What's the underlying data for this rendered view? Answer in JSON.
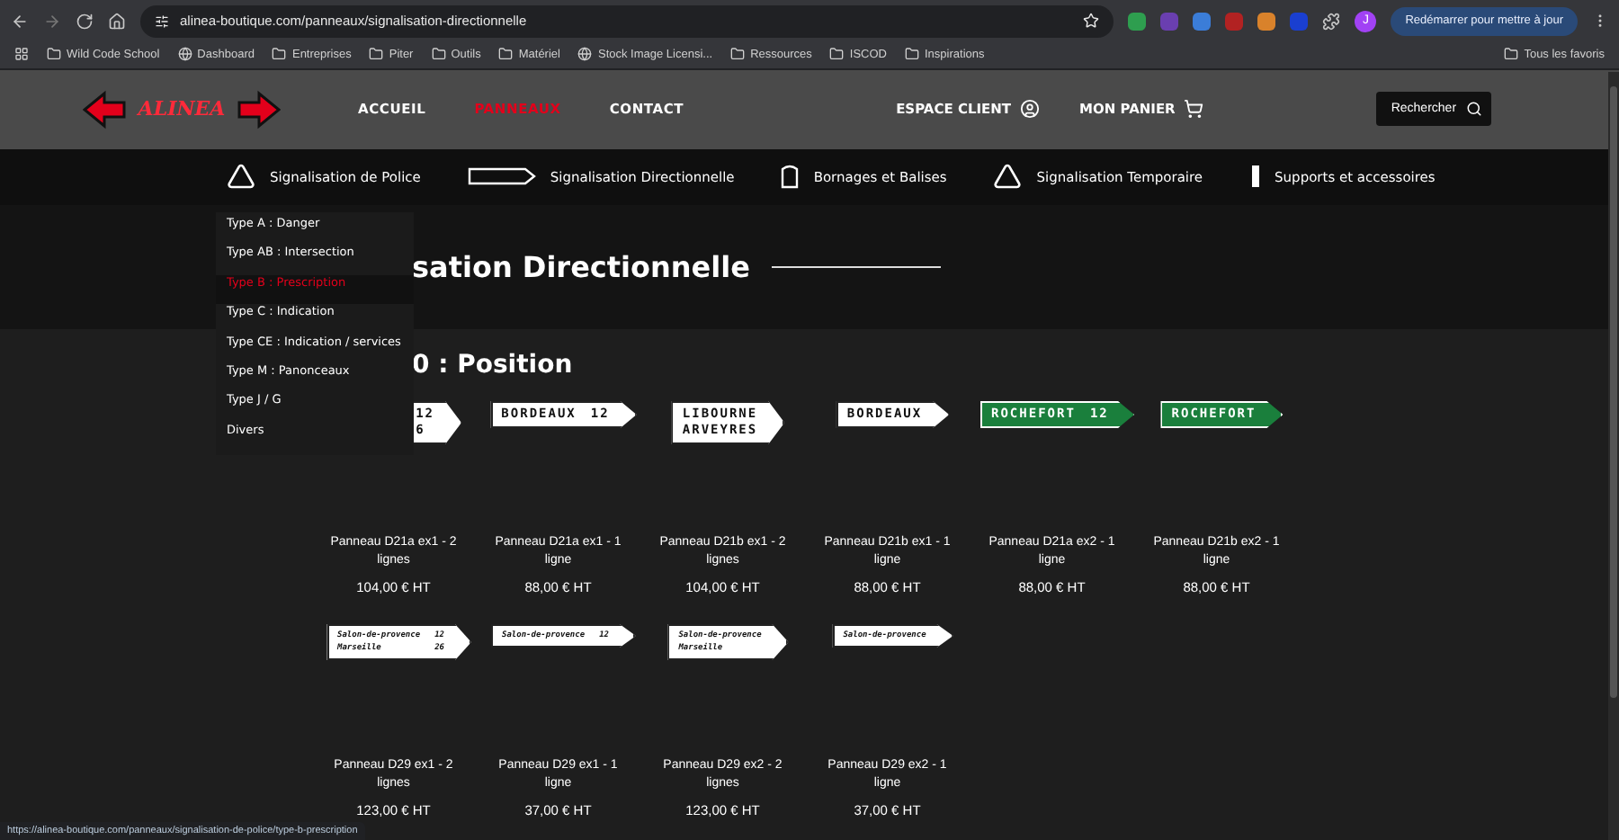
{
  "browser": {
    "url": "alinea-boutique.com/panneaux/signalisation-directionnelle",
    "profile_initial": "J",
    "update_button": "Redémarrer pour mettre à jour",
    "bookmarks": [
      {
        "label": "Wild Code School",
        "kind": "folder"
      },
      {
        "label": "Dashboard",
        "kind": "site"
      },
      {
        "label": "Entreprises",
        "kind": "folder"
      },
      {
        "label": "Piter",
        "kind": "folder"
      },
      {
        "label": "Outils",
        "kind": "folder"
      },
      {
        "label": "Matériel",
        "kind": "folder"
      },
      {
        "label": "Stock Image Licensi...",
        "kind": "site"
      },
      {
        "label": "Ressources",
        "kind": "folder"
      },
      {
        "label": "ISCOD",
        "kind": "folder"
      },
      {
        "label": "Inspirations",
        "kind": "folder"
      }
    ],
    "all_bookmarks": "Tous les favoris",
    "status_url": "https://alinea-boutique.com/panneaux/signalisation-de-police/type-b-prescription"
  },
  "header": {
    "logo": "ALINEA",
    "menu": [
      {
        "label": "ACCUEIL",
        "selected": false
      },
      {
        "label": "PANNEAUX",
        "selected": true
      },
      {
        "label": "CONTACT",
        "selected": false
      }
    ],
    "account": "ESPACE CLIENT",
    "cart": "MON PANIER",
    "search_button": "Rechercher"
  },
  "categories": [
    {
      "label": "Signalisation de Police",
      "kind": "triangle"
    },
    {
      "label": "Signalisation Directionnelle",
      "kind": "arrow"
    },
    {
      "label": "Bornages et Balises",
      "kind": "bollard"
    },
    {
      "label": "Signalisation Temporaire",
      "kind": "warning"
    },
    {
      "label": "Supports et accessoires",
      "kind": "post"
    }
  ],
  "dropdown": [
    {
      "label": "Type A : Danger",
      "selected": false
    },
    {
      "label": "Type AB : Intersection",
      "selected": false
    },
    {
      "label": "Type B : Prescription",
      "selected": true
    },
    {
      "label": "Type C : Indication",
      "selected": false
    },
    {
      "label": "Type CE : Indication / services",
      "selected": false
    },
    {
      "label": "Type M : Panonceaux",
      "selected": false
    },
    {
      "label": "Type J / G",
      "selected": false
    },
    {
      "label": "Divers",
      "selected": false
    }
  ],
  "page_title": "sation Directionnelle",
  "section_title": "0 : Position",
  "products": [
    {
      "name": "Panneau D21a ex1 - 2 lignes",
      "price": "104,00 € HT",
      "sign": {
        "kind": "block",
        "color": "#ffffff",
        "lines": [
          [
            "12"
          ],
          [
            "6"
          ]
        ]
      }
    },
    {
      "name": "Panneau D21a ex1 - 1 ligne",
      "price": "88,00 € HT",
      "sign": {
        "kind": "block",
        "color": "#ffffff",
        "lines": [
          [
            "BORDEAUX",
            "12"
          ]
        ]
      }
    },
    {
      "name": "Panneau D21b ex1 - 2 lignes",
      "price": "104,00 € HT",
      "sign": {
        "kind": "block",
        "color": "#ffffff",
        "lines": [
          [
            "LIBOURNE"
          ],
          [
            "ARVEYRES"
          ]
        ]
      }
    },
    {
      "name": "Panneau D21b ex1 - 1 ligne",
      "price": "88,00 € HT",
      "sign": {
        "kind": "block",
        "color": "#ffffff",
        "lines": [
          [
            "BORDEAUX"
          ]
        ]
      }
    },
    {
      "name": "Panneau D21a ex2 - 1 ligne",
      "price": "88,00 € HT",
      "sign": {
        "kind": "block",
        "color": "#1a7f3c",
        "lines": [
          [
            "ROCHEFORT",
            "12"
          ]
        ]
      }
    },
    {
      "name": "Panneau D21b ex2 - 1 ligne",
      "price": "88,00 € HT",
      "sign": {
        "kind": "block",
        "color": "#1a7f3c",
        "lines": [
          [
            "ROCHEFORT"
          ]
        ]
      }
    },
    {
      "name": "Panneau D29 ex1 - 2 lignes",
      "price": "123,00 € HT",
      "sign": {
        "kind": "italic",
        "color": "#ffffff",
        "lines": [
          [
            "Salon-de-provence",
            "12"
          ],
          [
            "Marseille",
            "26"
          ]
        ]
      }
    },
    {
      "name": "Panneau D29 ex1 - 1 ligne",
      "price": "37,00 € HT",
      "sign": {
        "kind": "italic",
        "color": "#ffffff",
        "lines": [
          [
            "Salon-de-provence",
            "12"
          ]
        ]
      }
    },
    {
      "name": "Panneau D29 ex2 - 2 lignes",
      "price": "123,00 € HT",
      "sign": {
        "kind": "italic",
        "color": "#ffffff",
        "lines": [
          [
            "Salon-de-provence"
          ],
          [
            "Marseille"
          ]
        ]
      }
    },
    {
      "name": "Panneau D29 ex2 - 1 ligne",
      "price": "37,00 € HT",
      "sign": {
        "kind": "italic",
        "color": "#ffffff",
        "lines": [
          [
            "Salon-de-provence"
          ]
        ]
      }
    }
  ]
}
